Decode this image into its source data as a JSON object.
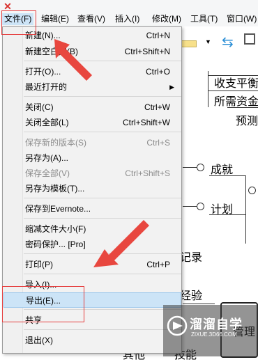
{
  "menubar": {
    "items": [
      {
        "label": "文件(F)"
      },
      {
        "label": "编辑(E)"
      },
      {
        "label": "查看(V)"
      },
      {
        "label": "插入(I)"
      },
      {
        "label": "修改(M)"
      },
      {
        "label": "工具(T)"
      },
      {
        "label": "窗口(W)"
      }
    ]
  },
  "file_menu": {
    "items": [
      {
        "label": "新建(N)...",
        "shortcut": "Ctrl+N"
      },
      {
        "label": "新建空白图(B)",
        "shortcut": "Ctrl+Shift+N"
      },
      {
        "label": "打开(O)...",
        "shortcut": "Ctrl+O"
      },
      {
        "label": "最近打开的",
        "shortcut": ""
      },
      {
        "label": "关闭(C)",
        "shortcut": "Ctrl+W"
      },
      {
        "label": "关闭全部(L)",
        "shortcut": "Ctrl+Shift+W"
      },
      {
        "label": "保存新的版本(S)",
        "shortcut": "Ctrl+S"
      },
      {
        "label": "另存为(A)...",
        "shortcut": ""
      },
      {
        "label": "保存全部(V)",
        "shortcut": "Ctrl+Shift+S"
      },
      {
        "label": "另存为模板(T)...",
        "shortcut": ""
      },
      {
        "label": "保存到Evernote...",
        "shortcut": ""
      },
      {
        "label": "缩减文件大小(F)",
        "shortcut": ""
      },
      {
        "label": "密码保护... [Pro]",
        "shortcut": ""
      },
      {
        "label": "打印(P)",
        "shortcut": "Ctrl+P"
      },
      {
        "label": "导入(I)...",
        "shortcut": ""
      },
      {
        "label": "导出(E)...",
        "shortcut": ""
      },
      {
        "label": "共享",
        "shortcut": ""
      },
      {
        "label": "退出(X)",
        "shortcut": ""
      }
    ]
  },
  "mindmap": {
    "nodes": [
      "收支平衡",
      "所需资金",
      "预测",
      "成就",
      "计划",
      "记录",
      "经验",
      "管理",
      "技能",
      "其他"
    ]
  },
  "watermark": {
    "title": "溜溜自学",
    "sub": "ZIXUE.3D66.COM"
  },
  "colors": {
    "highlight": "#e53d3d",
    "hover": "#cce4f7",
    "brand": "#d9322f"
  }
}
